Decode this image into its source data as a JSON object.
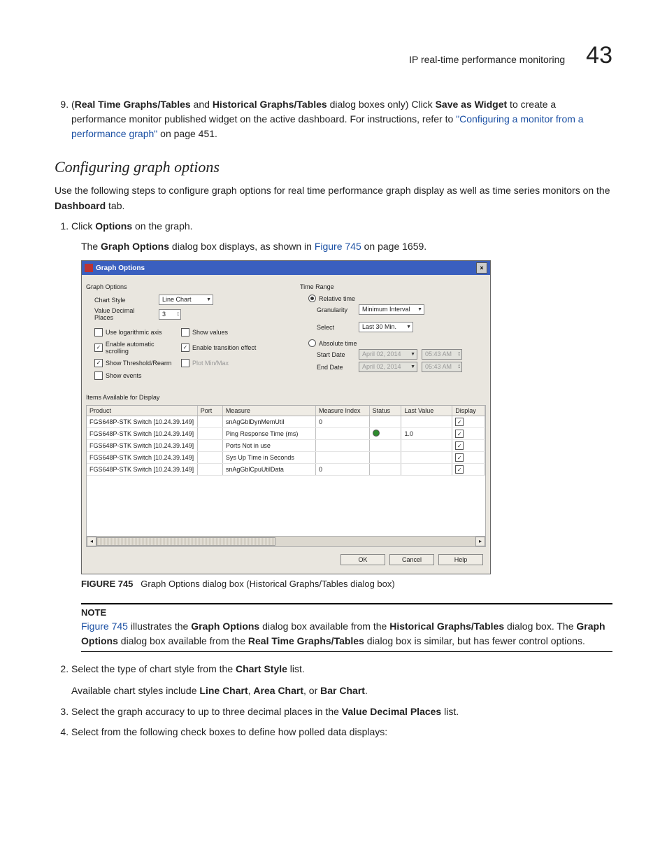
{
  "header": {
    "title": "IP real-time performance monitoring",
    "chapter": "43"
  },
  "step9": {
    "num": "9.",
    "pre_paren": "(",
    "bold1": "Real Time Graphs/Tables",
    "and": " and ",
    "bold2": "Historical Graphs/Tables",
    "post1": " dialog boxes only) Click ",
    "bold3": "Save as Widget",
    "post2": " to create a performance monitor published widget on the active dashboard. For instructions, refer to ",
    "linktext": "\"Configuring a monitor from a performance graph\"",
    "post3": " on page 451."
  },
  "section": "Configuring graph options",
  "intro": {
    "pre": "Use the following steps to configure graph options for real time performance graph display as well as time series monitors on the ",
    "bold": "Dashboard",
    "post": " tab."
  },
  "step1": {
    "num": "1.",
    "pre": "Click ",
    "bold": "Options",
    "post": " on the graph.",
    "res_pre": "The ",
    "res_bold": "Graph Options",
    "res_mid": " dialog box displays, as shown in ",
    "res_link": "Figure 745",
    "res_post": " on page 1659."
  },
  "dialog": {
    "title": "Graph Options",
    "left_header": "Graph Options",
    "chart_style_label": "Chart Style",
    "chart_style_value": "Line Chart",
    "decimal_label": "Value Decimal Places",
    "decimal_value": "3",
    "cbs": {
      "log": "Use logarithmic axis",
      "showvals": "Show values",
      "autoscroll": "Enable automatic scrolling",
      "transition": "Enable transition effect",
      "threshold": "Show Threshold/Rearm",
      "plotminmax": "Plot Min/Max",
      "events": "Show events"
    },
    "right_header": "Time Range",
    "relative_label": "Relative time",
    "granularity_label": "Granularity",
    "granularity_value": "Minimum Interval",
    "select_label": "Select",
    "select_value": "Last 30 Min.",
    "absolute_label": "Absolute time",
    "startdate_label": "Start Date",
    "enddate_label": "End Date",
    "date_value": "April 02, 2014",
    "time_value": "05:43 AM",
    "items_label": "Items Available for Display",
    "columns": [
      "Product",
      "Port",
      "Measure",
      "Measure Index",
      "Status",
      "Last Value",
      "Display"
    ],
    "rows": [
      {
        "product": "FGS648P-STK Switch [10.24.39.149]",
        "port": "",
        "measure": "snAgGblDynMemUtil",
        "index": "0",
        "status": "",
        "last": "",
        "display": true
      },
      {
        "product": "FGS648P-STK Switch [10.24.39.149]",
        "port": "",
        "measure": "Ping Response Time (ms)",
        "index": "",
        "status": "dot",
        "last": "1.0",
        "display": true
      },
      {
        "product": "FGS648P-STK Switch [10.24.39.149]",
        "port": "",
        "measure": "Ports Not in use",
        "index": "",
        "status": "",
        "last": "",
        "display": true
      },
      {
        "product": "FGS648P-STK Switch [10.24.39.149]",
        "port": "",
        "measure": "Sys Up Time in Seconds",
        "index": "",
        "status": "",
        "last": "",
        "display": true
      },
      {
        "product": "FGS648P-STK Switch [10.24.39.149]",
        "port": "",
        "measure": "snAgGblCpuUtilData",
        "index": "0",
        "status": "",
        "last": "",
        "display": true
      }
    ],
    "buttons": {
      "ok": "OK",
      "cancel": "Cancel",
      "help": "Help"
    }
  },
  "fig_caption": {
    "label": "FIGURE 745",
    "text": "Graph Options dialog box (Historical Graphs/Tables dialog box)"
  },
  "note": {
    "title": "NOTE",
    "link": "Figure 745",
    "t1": " illustrates the ",
    "b1": "Graph Options",
    "t2": " dialog box available from the ",
    "b2": "Historical Graphs/Tables",
    "t3": " dialog box. The ",
    "b3": "Graph Options",
    "t4": " dialog box available from the ",
    "b4": "Real Time Graphs/Tables",
    "t5": " dialog box is similar, but has fewer control options."
  },
  "step2": {
    "num": "2.",
    "pre": "Select the type of chart style from the ",
    "bold": "Chart Style",
    "post": " list.",
    "follow_pre": "Available chart styles include ",
    "fb1": "Line Chart",
    "fc1": ", ",
    "fb2": "Area Chart",
    "fc2": ", or ",
    "fb3": "Bar Chart",
    "follow_post": "."
  },
  "step3": {
    "num": "3.",
    "pre": "Select the graph accuracy to up to three decimal places in the ",
    "bold": "Value Decimal Places",
    "post": " list."
  },
  "step4": {
    "num": "4.",
    "text": "Select from the following check boxes to define how polled data displays:"
  }
}
